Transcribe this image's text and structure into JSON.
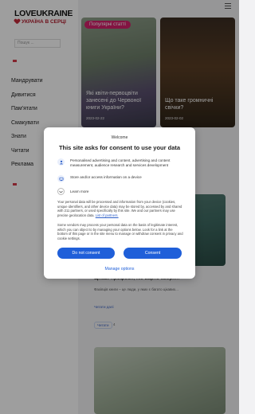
{
  "site": {
    "logo_main": "LOVEUKRAINE",
    "logo_sub": "УКРАЇНА В СЕРЦІ",
    "search_placeholder": "Пошук ..."
  },
  "nav": [
    "Мандрувати",
    "Дивитися",
    "Пам'ятати",
    "Смакувати",
    "Знати",
    "Читати",
    "Реклама"
  ],
  "hero": {
    "pill": "Популярні статті",
    "left_title": "Які квіти-первоцвіти занесені до Червоної книги України?",
    "left_date": "2023-02-22",
    "right_title": "Що таке громничні свічки?",
    "right_date": "2023-02-02"
  },
  "article": {
    "title": "Цікаві професії, які варто зверх...",
    "excerpt": "Фахівців книги – це люди, у яких є багато цікавих...",
    "read_more": "Читати далі",
    "tag": "Читати",
    "count": "4"
  },
  "consent": {
    "welcome": "Welcome",
    "title": "This site asks for consent to use your data",
    "purpose1": "Personalised advertising and content, advertising and content measurement, audience research and services development",
    "purpose2": "Store and/or access information on a device",
    "learn_more": "Learn more",
    "para1": "Your personal data will be processed and information from your device (cookies, unique identifiers, and other device data) may be stored by, accessed by and shared with 211 partners, or used specifically by this site. We and our partners may use precise geolocation data.",
    "para1_link": "List of partners.",
    "para2": "Some vendors may process your personal data on the basis of legitimate interest, which you can object to by managing your options below. Look for a link at the bottom of this page or in the site menu to manage or withdraw consent in privacy and cookie settings.",
    "do_not_consent": "Do not consent",
    "consent": "Consent",
    "manage_options": "Manage options"
  },
  "colors": {
    "accent": "#1f5fd9",
    "pill": "#d4216b",
    "overlay": "rgba(0,0,0,0.38)"
  },
  "icons": {
    "purpose1": "person-icon",
    "purpose2": "device-icon",
    "learn_more": "chevron-down-icon",
    "menu": "hamburger-icon"
  }
}
